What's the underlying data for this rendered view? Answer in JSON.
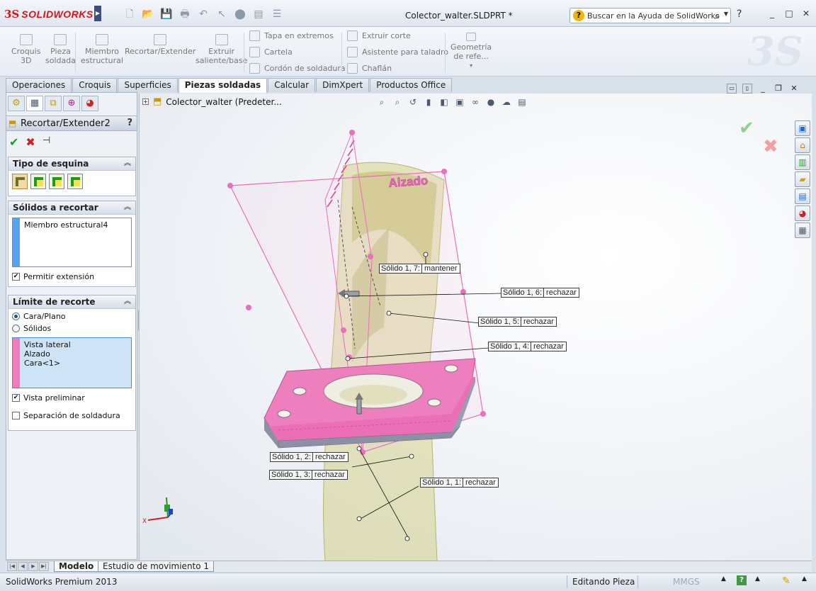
{
  "app": {
    "brand_prefix": "3S",
    "brand": "SOLIDWORKS",
    "document_title": "Colector_walter.SLDPRT *",
    "search_placeholder": "Buscar en la Ayuda de SolidWorks",
    "help_glyph": "?",
    "window_controls": [
      "_",
      "□",
      "✕"
    ]
  },
  "command_manager": {
    "big_buttons": [
      {
        "label1": "Croquis",
        "label2": "3D"
      },
      {
        "label1": "Pieza",
        "label2": "soldada"
      },
      {
        "label1": "Miembro",
        "label2": "estructural"
      },
      {
        "label1": "Recortar/Extender",
        "label2": ""
      },
      {
        "label1": "Extruir",
        "label2": "saliente/base"
      }
    ],
    "col1": [
      "Tapa en extremos",
      "Cartela",
      "Cordón de soldadura"
    ],
    "col2": [
      "Extruir corte",
      "Asistente para taladro",
      "Chaflán"
    ],
    "ref_geometry": {
      "label1": "Geometría",
      "label2": "de refe..."
    }
  },
  "tabs": [
    "Operaciones",
    "Croquis",
    "Superficies",
    "Piezas soldadas",
    "Calcular",
    "DimXpert",
    "Productos Office"
  ],
  "active_tab": "Piezas soldadas",
  "property_manager": {
    "title": "Recortar/Extender2",
    "help": "?",
    "groups": {
      "corner": {
        "title": "Tipo de esquina"
      },
      "bodies": {
        "title": "Sólidos a recortar",
        "items": [
          "Miembro estructural4"
        ],
        "allow_extension": "Permitir extensión"
      },
      "limit": {
        "title": "Límite de recorte",
        "radio1": "Cara/Plano",
        "radio2": "Sólidos",
        "items": [
          "Vista lateral",
          "Alzado",
          "Cara<1>"
        ],
        "preview": "Vista preliminar",
        "weld_gap": "Separación de soldadura"
      }
    }
  },
  "graphics": {
    "tree_root": "Colector_walter  (Predeter...",
    "plane_label": "Alzado",
    "callouts": [
      {
        "name": "Sólido 1,  7:",
        "action": "mantener"
      },
      {
        "name": "Sólido 1,  6:",
        "action": "rechazar"
      },
      {
        "name": "Sólido 1,  5:",
        "action": "rechazar"
      },
      {
        "name": "Sólido 1,  4:",
        "action": "rechazar"
      },
      {
        "name": "Sólido 1,  2:",
        "action": "rechazar"
      },
      {
        "name": "Sólido 1,  3:",
        "action": "rechazar"
      },
      {
        "name": "Sólido 1,  1:",
        "action": "rechazar"
      }
    ],
    "axis_x": "X"
  },
  "bottom_tabs": [
    "Modelo",
    "Estudio de movimiento 1"
  ],
  "status": {
    "product": "SolidWorks Premium 2013",
    "mode": "Editando Pieza",
    "units": "MMGS"
  }
}
